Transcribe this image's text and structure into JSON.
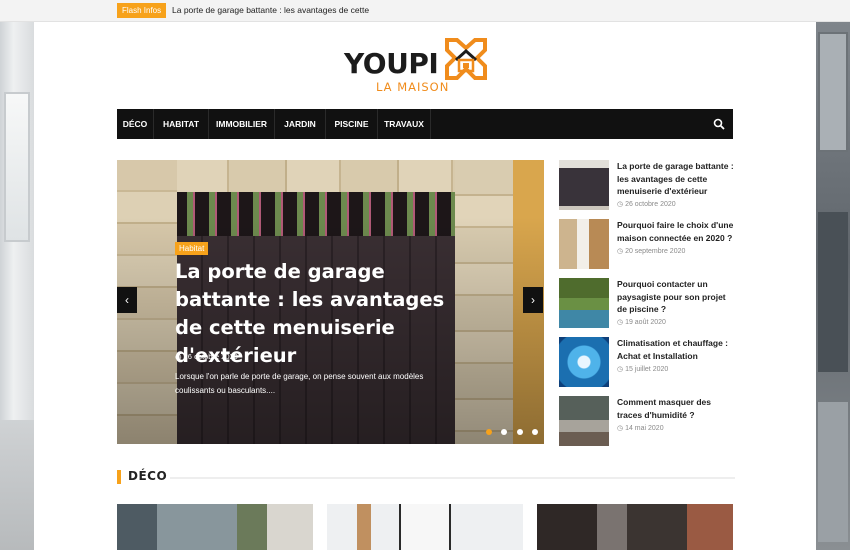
{
  "flash": {
    "label": "Flash Infos",
    "headline": "La porte de garage battante : les avantages de cette"
  },
  "logo": {
    "word": "YOUPI",
    "subtitle": "LA MAISON",
    "colors": {
      "dark": "#1c1c1c",
      "orange": "#f08c1c"
    }
  },
  "nav": {
    "items": [
      {
        "label": "DÉCO"
      },
      {
        "label": "HABITAT"
      },
      {
        "label": "IMMOBILIER"
      },
      {
        "label": "JARDIN"
      },
      {
        "label": "PISCINE"
      },
      {
        "label": "TRAVAUX"
      }
    ],
    "search_icon": "search-icon"
  },
  "slider": {
    "category": "Habitat",
    "title": "La porte de garage battante : les avantages de cette menuiserie d'extérieur",
    "date": "26 octobre 2020",
    "excerpt": "Lorsque l'on parle de porte de garage, on pense souvent aux modèles coulissants ou basculants....",
    "prev_icon": "chevron-left-icon",
    "next_icon": "chevron-right-icon",
    "dots_count": 4,
    "active_dot": 0
  },
  "recent_posts": [
    {
      "title": "La porte de garage battante : les avantages de cette menuiserie d'extérieur",
      "date": "26 octobre 2020"
    },
    {
      "title": "Pourquoi faire le choix d'une maison connectée en 2020 ?",
      "date": "20 septembre 2020"
    },
    {
      "title": "Pourquoi contacter un paysagiste pour son projet de piscine ?",
      "date": "19 août 2020"
    },
    {
      "title": "Climatisation et chauffage : Achat et Installation",
      "date": "15 juillet 2020"
    },
    {
      "title": "Comment masquer des traces d'humidité ?",
      "date": "14 mai 2020"
    }
  ],
  "section": {
    "title": "DÉCO"
  },
  "accent_color": "#f7a21b"
}
